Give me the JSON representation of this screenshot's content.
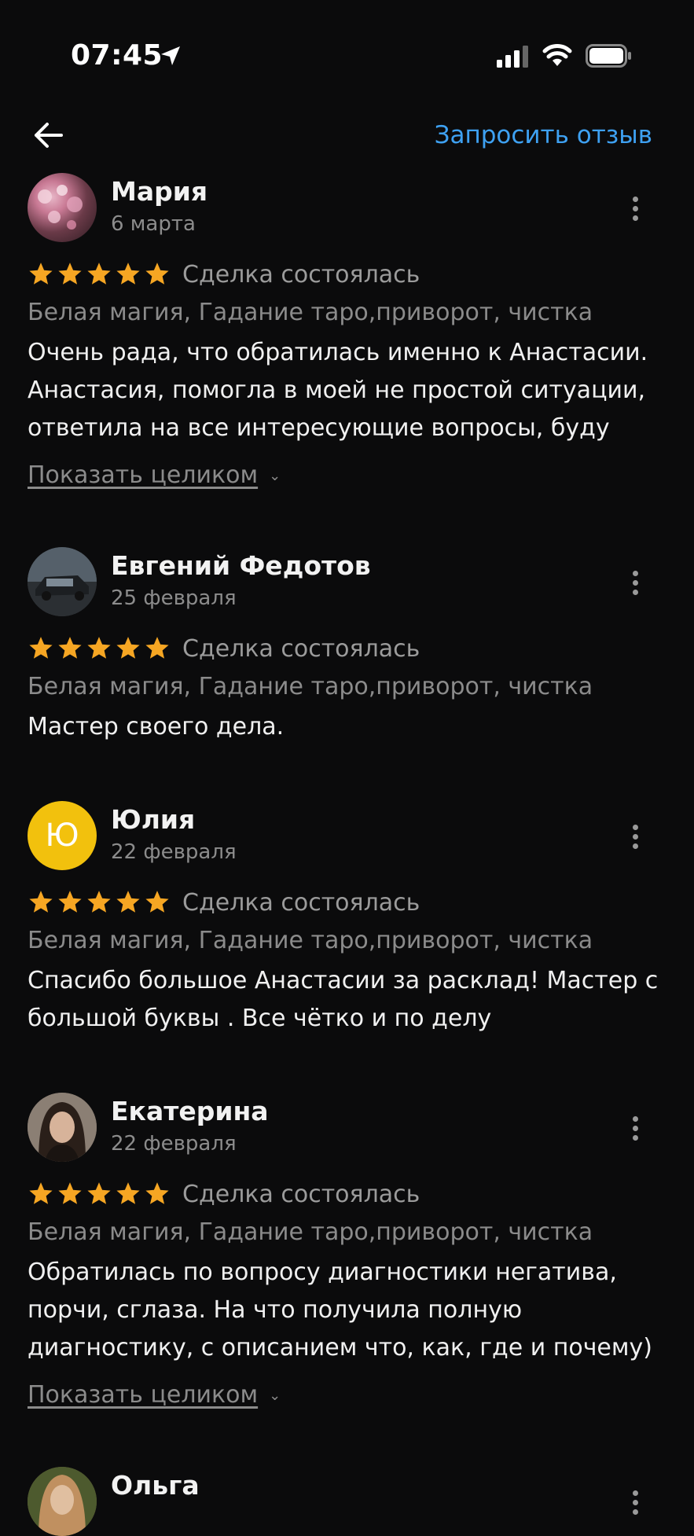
{
  "status_bar": {
    "time": "07:45"
  },
  "header": {
    "request_review": "Запросить отзыв"
  },
  "reviews": [
    {
      "name": "Мария",
      "date": "6 марта",
      "rating": 5,
      "deal": "Сделка состоялась",
      "tags": "Белая магия, Гадание таро,приворот, чистка",
      "text": "Очень рада, что обратилась именно к Анастасии. Анастасия, помогла в моей не простой ситуации, ответила на все интересующие вопросы, буду",
      "show_more": "Показать целиком"
    },
    {
      "name": "Евгений Федотов",
      "date": "25 февраля",
      "rating": 5,
      "deal": "Сделка состоялась",
      "tags": "Белая магия, Гадание таро,приворот, чистка",
      "text": "Мастер своего дела."
    },
    {
      "name": "Юлия",
      "date": "22 февраля",
      "avatar_letter": "Ю",
      "rating": 5,
      "deal": "Сделка состоялась",
      "tags": "Белая магия, Гадание таро,приворот, чистка",
      "text": "Спасибо большое Анастасии за расклад! Мастер с большой буквы . Все чётко и по делу"
    },
    {
      "name": "Екатерина",
      "date": "22 февраля",
      "rating": 5,
      "deal": "Сделка состоялась",
      "tags": "Белая магия, Гадание таро,приворот, чистка",
      "text": "Обратилась по вопросу диагностики негатива, порчи, сглаза. На что получила полную диагностику, с описанием что, как, где и почему)",
      "show_more": "Показать целиком"
    },
    {
      "name": "Ольга"
    }
  ],
  "colors": {
    "accent": "#3ea1f2",
    "star": "#f6a623",
    "avatar_yellow": "#f2c10d"
  }
}
